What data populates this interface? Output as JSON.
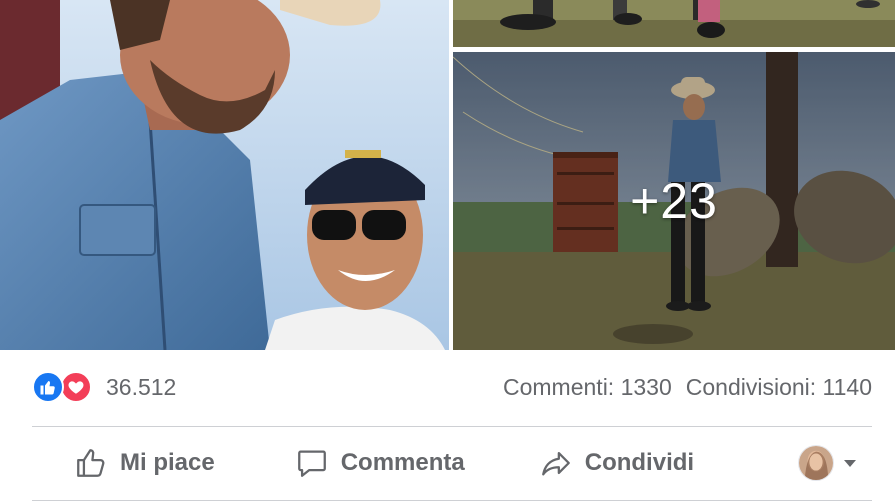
{
  "post": {
    "photos": {
      "main_alt": "photo",
      "more_count": "+23"
    },
    "stats": {
      "reactions": [
        "like-reaction-icon",
        "love-reaction-icon"
      ],
      "reaction_count": "36.512",
      "comments": "Commenti: 1330",
      "shares": "Condivisioni: 1140"
    },
    "actions": {
      "like_label": "Mi piace",
      "comment_label": "Commenta",
      "share_label": "Condividi"
    }
  },
  "colors": {
    "like_blue": "#1877f2",
    "love_red": "#f33e58",
    "text_gray": "#65676b",
    "divider": "#ced0d4"
  }
}
